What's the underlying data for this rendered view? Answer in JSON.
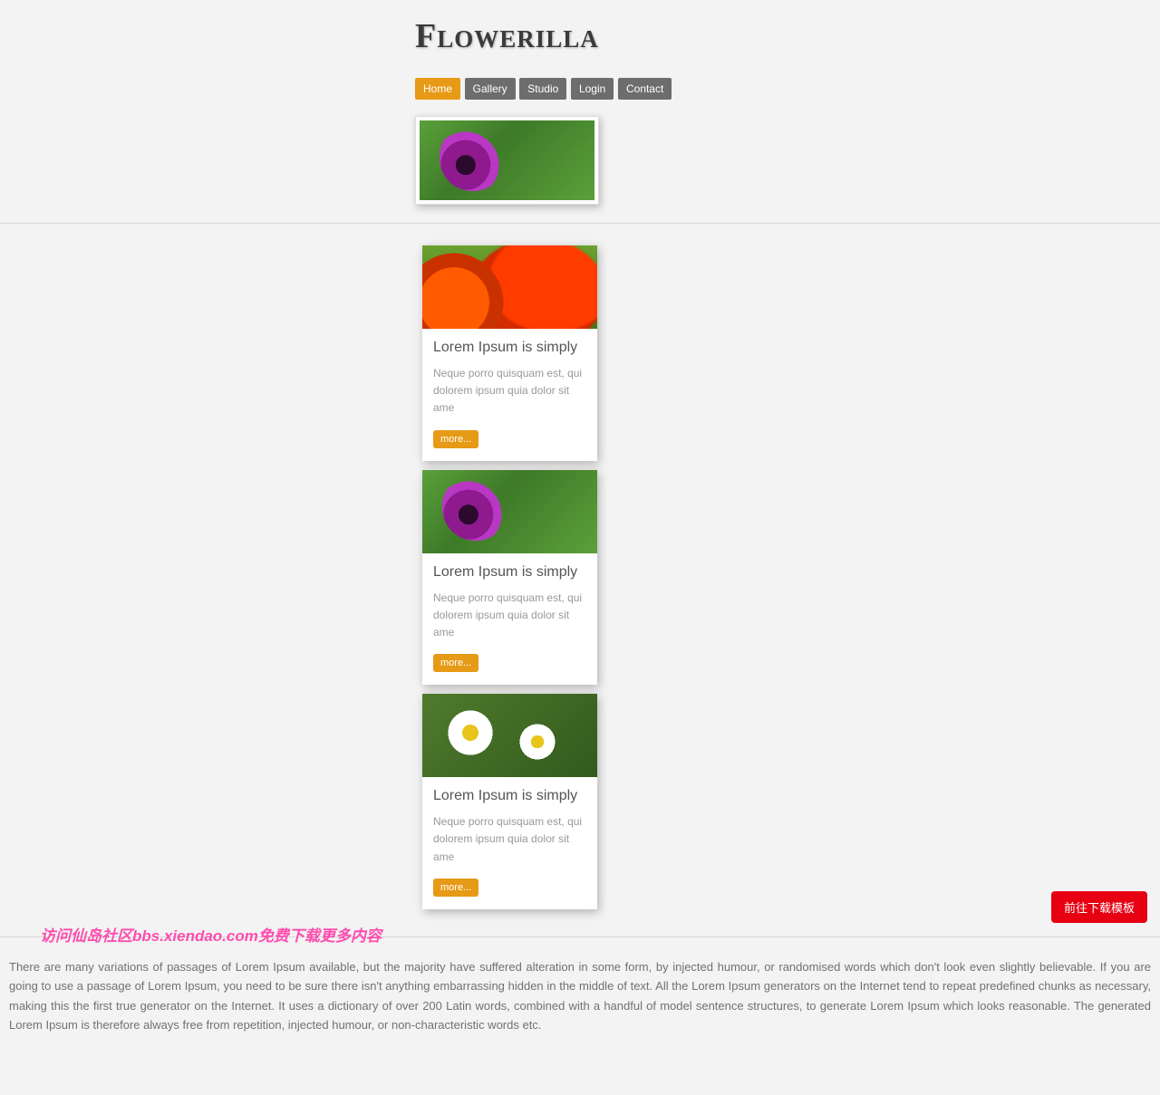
{
  "site": {
    "title": "Flowerilla"
  },
  "nav": {
    "items": [
      {
        "label": "Home",
        "active": true
      },
      {
        "label": "Gallery",
        "active": false
      },
      {
        "label": "Studio",
        "active": false
      },
      {
        "label": "Login",
        "active": false
      },
      {
        "label": "Contact",
        "active": false
      }
    ]
  },
  "cards": [
    {
      "title": "Lorem Ipsum is simply",
      "desc": "Neque porro quisquam est, qui dolorem ipsum quia dolor sit ame",
      "more": "more..."
    },
    {
      "title": "Lorem Ipsum is simply",
      "desc": "Neque porro quisquam est, qui dolorem ipsum quia dolor sit ame",
      "more": "more..."
    },
    {
      "title": "Lorem Ipsum is simply",
      "desc": "Neque porro quisquam est, qui dolorem ipsum quia dolor sit ame",
      "more": "more..."
    }
  ],
  "footer": {
    "text": "There are many variations of passages of Lorem Ipsum available, but the majority have suffered alteration in some form, by injected humour, or randomised words which don't look even slightly believable. If you are going to use a passage of Lorem Ipsum, you need to be sure there isn't anything embarrassing hidden in the middle of text. All the Lorem Ipsum generators on the Internet tend to repeat predefined chunks as necessary, making this the first true generator on the Internet. It uses a dictionary of over 200 Latin words, combined with a handful of model sentence structures, to generate Lorem Ipsum which looks reasonable. The generated Lorem Ipsum is therefore always free from repetition, injected humour, or non-characteristic words etc."
  },
  "floating_button": {
    "label": "前往下载模板"
  },
  "watermark": {
    "text": "访问仙岛社区bbs.xiendao.com免费下载更多内容"
  }
}
